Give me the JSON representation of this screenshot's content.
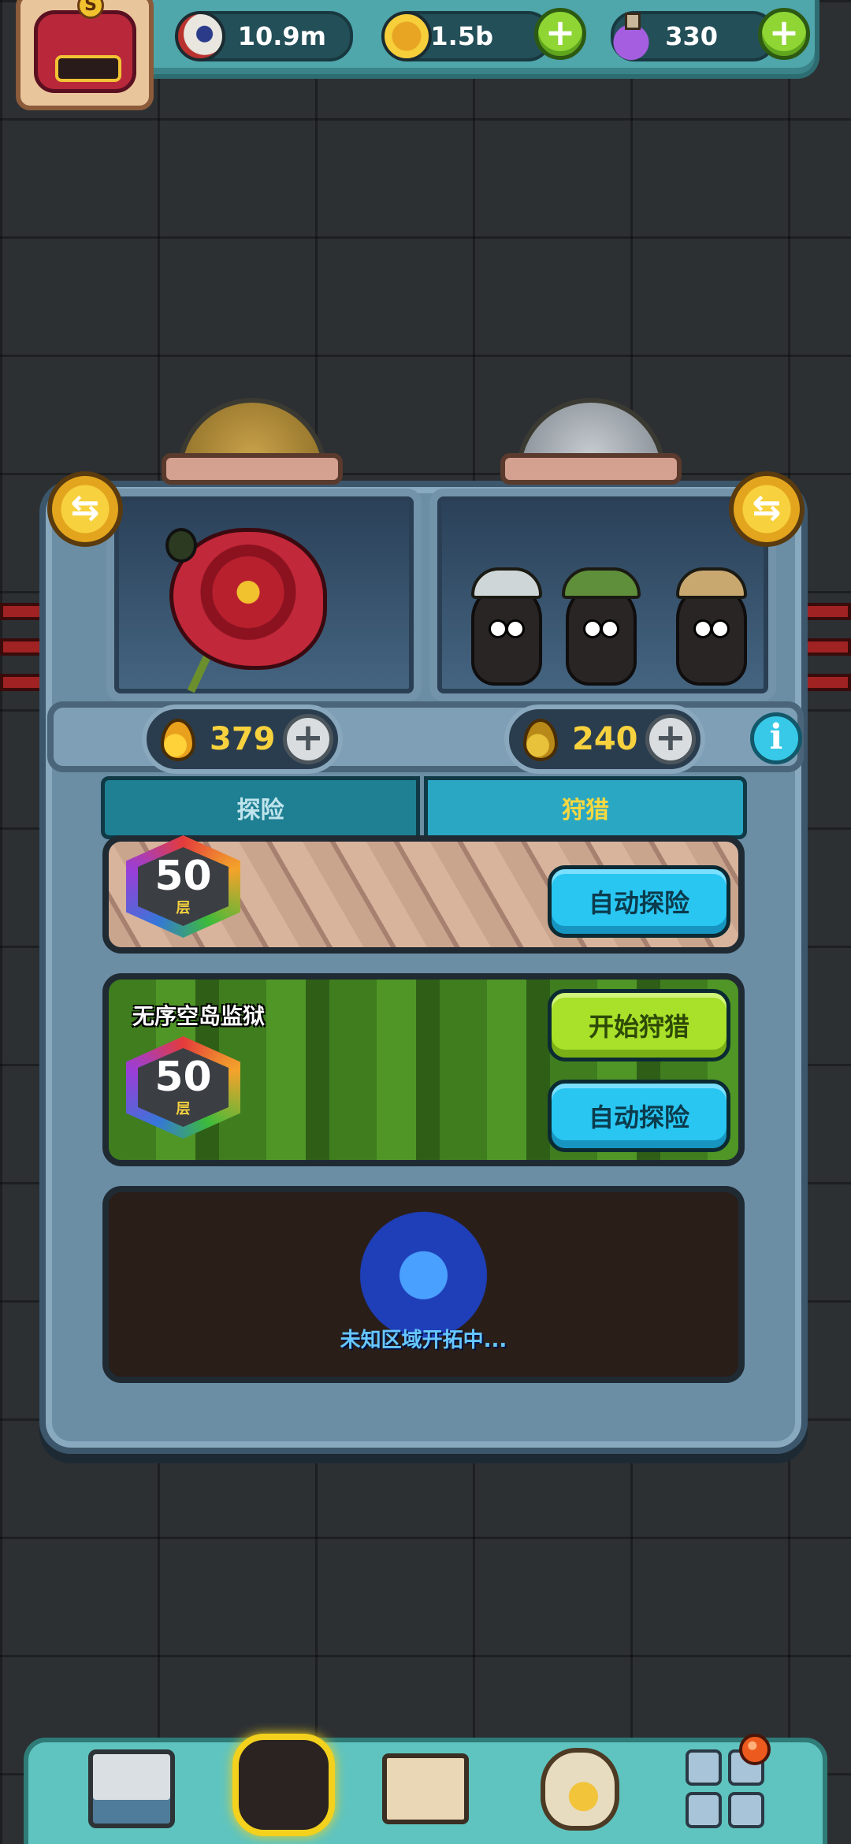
{
  "resources": {
    "eyes": "10.9m",
    "coins": "1.5b",
    "potions": "330",
    "add_label": "+"
  },
  "chambers": {
    "left_drops": "379",
    "right_drops": "240",
    "swap_label": "⇆",
    "add_label": "+",
    "info_label": "i"
  },
  "tabs": {
    "explore": "探险",
    "hunt": "狩猎",
    "active": "hunt"
  },
  "floors": [
    {
      "level": "50",
      "unit": "层",
      "auto_button": "自动探险"
    },
    {
      "title": "无序空岛监狱",
      "level": "50",
      "unit": "层",
      "hunt_button": "开始狩猎",
      "auto_button": "自动探险"
    },
    {
      "status": "未知区域开拓中..."
    }
  ],
  "bottom_nav": {
    "items": [
      "shop-icon",
      "monster-icon",
      "book-icon",
      "bag-icon",
      "menu-grid-icon"
    ],
    "active": "monster-icon",
    "has_notification": true
  }
}
